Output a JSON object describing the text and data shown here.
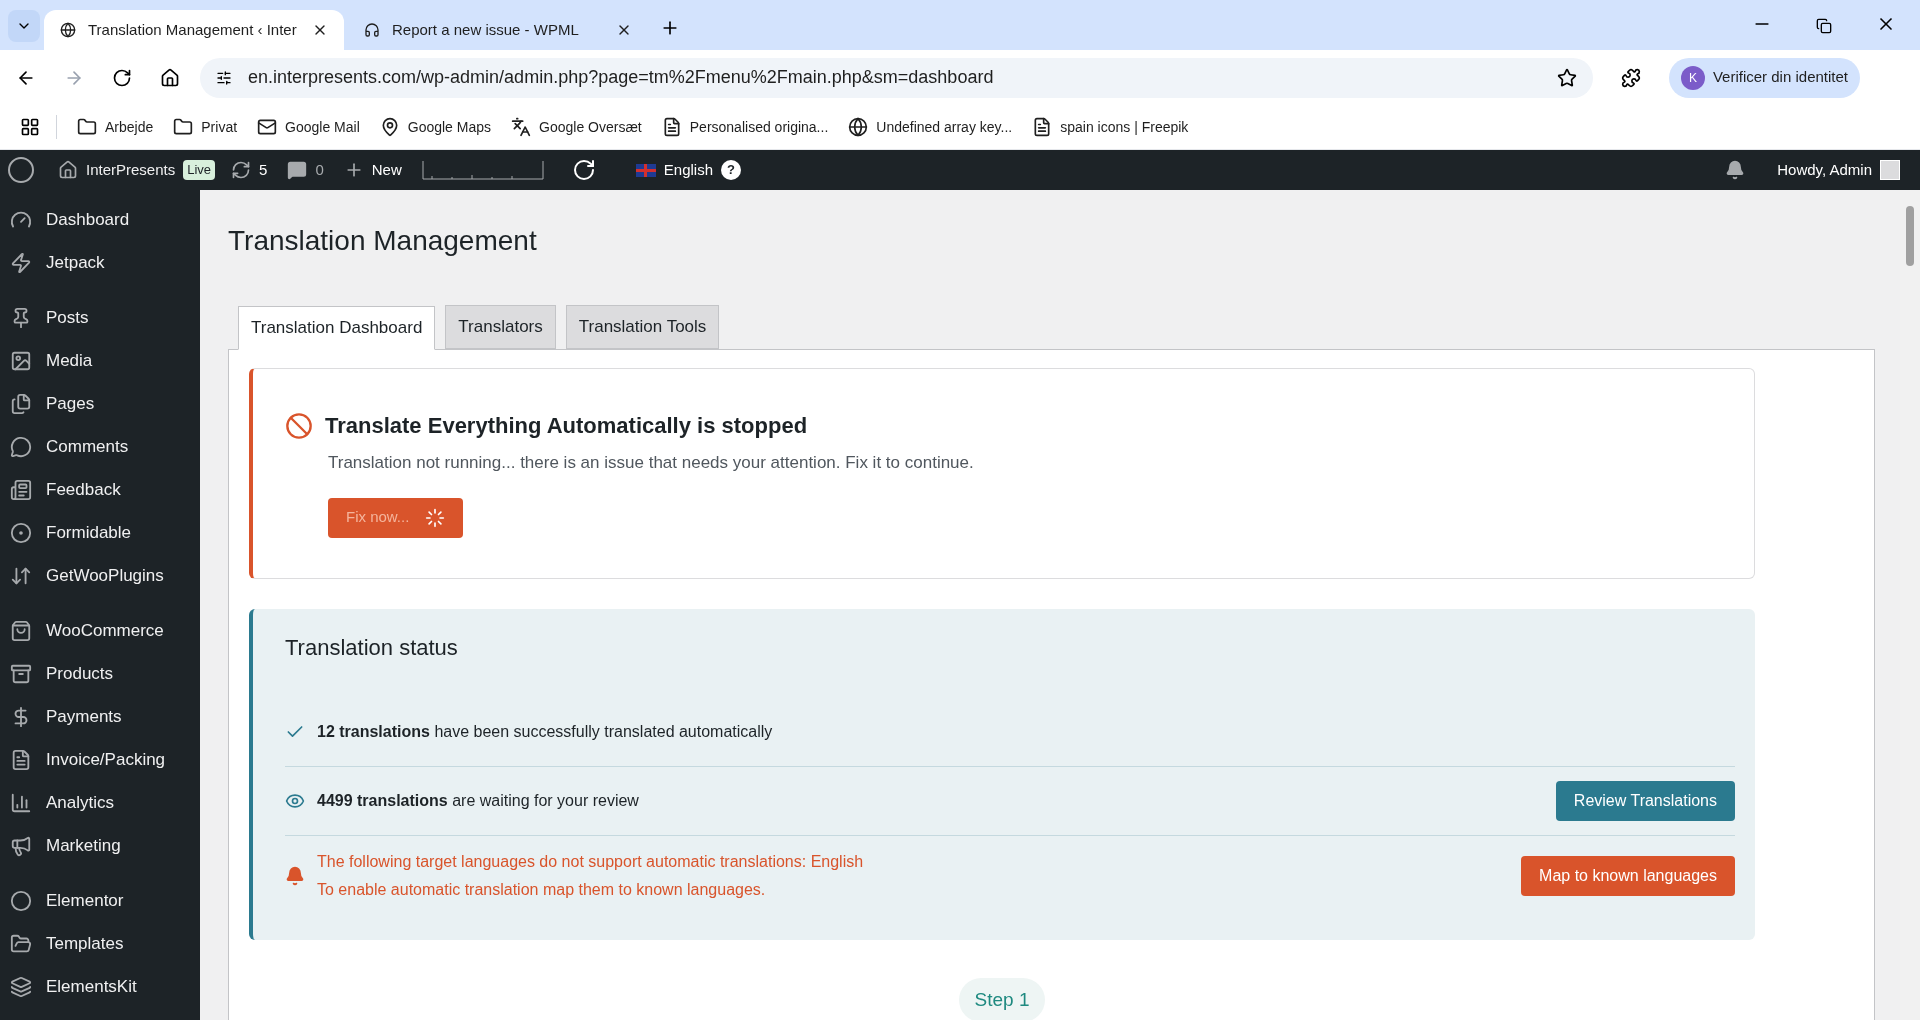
{
  "browser": {
    "tabs": [
      {
        "title": "Translation Management ‹ Inter",
        "selected": true
      },
      {
        "title": "Report a new issue - WPML",
        "selected": false
      }
    ],
    "url": "en.interpresents.com/wp-admin/admin.php?page=tm%2Fmenu%2Fmain.php&sm=dashboard",
    "profile_button": "Verificer din identitet",
    "profile_initial": "K",
    "bookmarks": [
      "Arbejde",
      "Privat",
      "Google Mail",
      "Google Maps",
      "Google Oversæt",
      "Personalised origina...",
      "Undefined array key...",
      "spain icons | Freepik"
    ]
  },
  "admin_bar": {
    "site_name": "InterPresents",
    "live_badge": "Live",
    "updates_count": "5",
    "comments_count": "0",
    "new_label": "New",
    "language": "English",
    "help": "?",
    "greeting": "Howdy, Admin"
  },
  "sidebar": {
    "groups": [
      [
        "Dashboard",
        "Jetpack"
      ],
      [
        "Posts",
        "Media",
        "Pages",
        "Comments",
        "Feedback",
        "Formidable",
        "GetWooPlugins"
      ],
      [
        "WooCommerce",
        "Products",
        "Payments",
        "Invoice/Packing",
        "Analytics",
        "Marketing"
      ],
      [
        "Elementor",
        "Templates",
        "ElementsKit"
      ]
    ]
  },
  "page": {
    "title": "Translation Management",
    "tabs": [
      {
        "label": "Translation Dashboard",
        "selected": true
      },
      {
        "label": "Translators",
        "selected": false
      },
      {
        "label": "Translation Tools",
        "selected": false
      }
    ],
    "notice": {
      "title": "Translate Everything Automatically is stopped",
      "message": "Translation not running... there is an issue that needs your attention. Fix it to continue.",
      "button": "Fix now..."
    },
    "status": {
      "title": "Translation status",
      "rows": [
        {
          "kind": "success",
          "lines": [
            "**12 translations** have been successfully translated automatically"
          ]
        },
        {
          "kind": "review",
          "lines": [
            "**4499 translations** are waiting for your review"
          ],
          "button": "Review Translations"
        },
        {
          "kind": "warning",
          "lines": [
            "The following target languages do not support automatic translations: English",
            "To enable automatic translation map them to known languages."
          ],
          "button": "Map to known languages"
        }
      ]
    },
    "step": "Step 1"
  }
}
